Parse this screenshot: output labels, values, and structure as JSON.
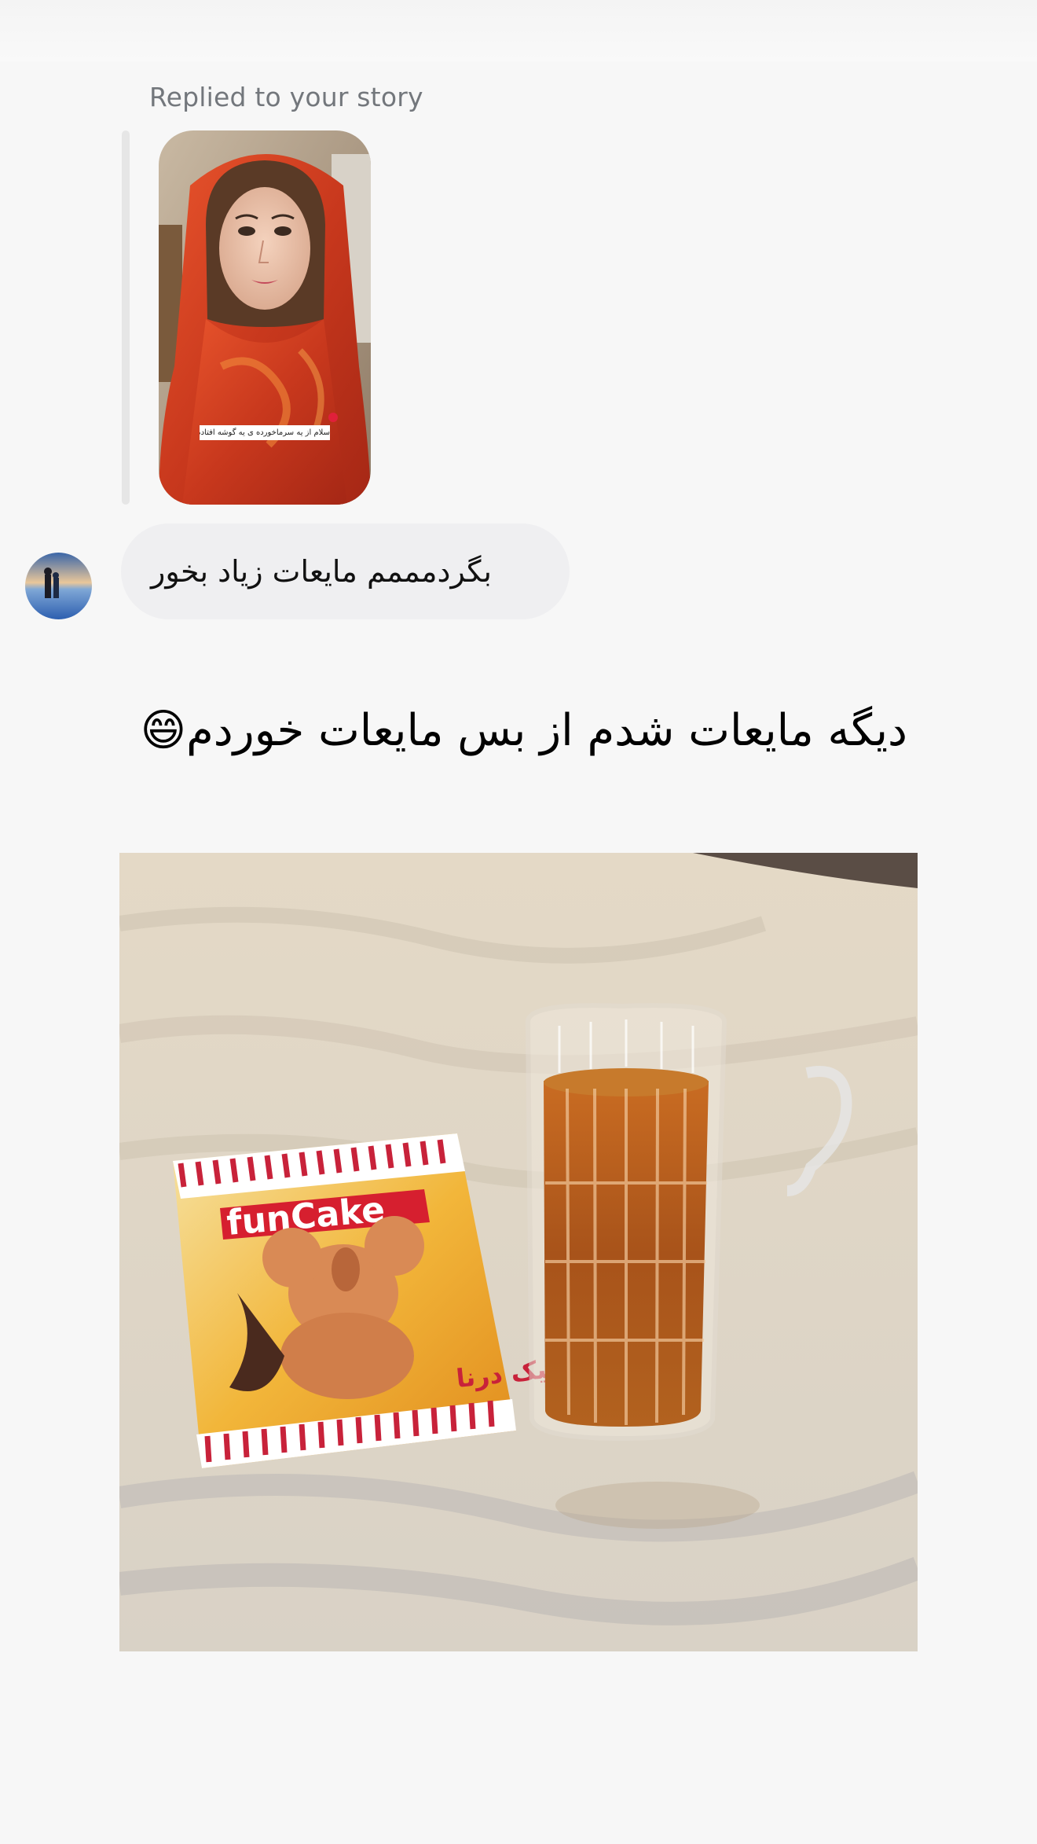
{
  "story_reply": {
    "label": "Replied to your story",
    "story_caption": "سلام از یه سرماخورده ی یه گوشه افتاده😂"
  },
  "message": {
    "text": "بگردمممم مایعات زیاد بخور"
  },
  "reply": {
    "text": "دیگه مایعات شدم از بس مایعات خوردم😄"
  },
  "photo": {
    "package_brand": "funCake",
    "package_label": "فان کیک درنا"
  }
}
